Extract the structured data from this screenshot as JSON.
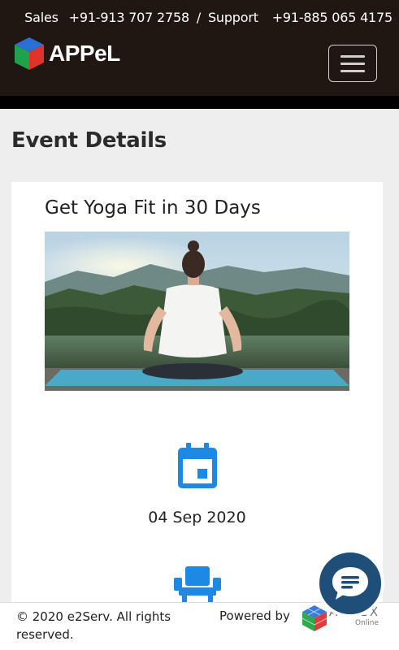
{
  "header": {
    "contact_sales": "Sales",
    "sales_phone": "+91-913 707 2758",
    "separator": "/",
    "contact_support": "Support",
    "support_phone": "+91-885 065 4175",
    "brand_name": "APPeL"
  },
  "page": {
    "title": "Event Details"
  },
  "event": {
    "title": "Get Yoga Fit in 30 Days",
    "date": "04 Sep 2020"
  },
  "footer": {
    "copyright": "© 2020 e2Serv. All rights reserved.",
    "powered_by": "Powered by",
    "appex_name": "APPEX",
    "appex_sub": "Online"
  },
  "colors": {
    "header_bg": "#211712",
    "accent_blue": "#1e88e5",
    "chat_bg": "#1f4e79"
  },
  "icons": {
    "menu": "hamburger-icon",
    "date": "calendar-icon",
    "venue": "chair-icon",
    "chat": "chat-icon"
  }
}
